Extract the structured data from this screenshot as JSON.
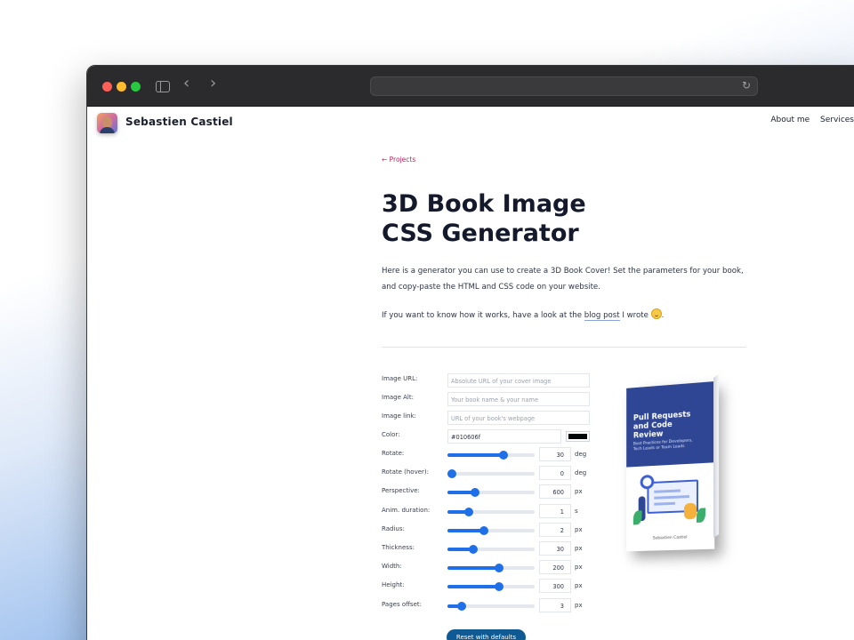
{
  "browser": {
    "url": ""
  },
  "site": {
    "name": "Sebastien Castiel",
    "nav": [
      "About me",
      "Services"
    ]
  },
  "article": {
    "back_link": "← Projects",
    "title_line1": "3D Book Image",
    "title_line2": "CSS Generator",
    "intro": "Here is a generator you can use to create a 3D Book Cover! Set the parameters for your book, and copy-paste the HTML and CSS code on your website.",
    "intro2_before": "If you want to know how it works, have a look at the ",
    "intro2_link": "blog post",
    "intro2_after": " I wrote",
    "intro2_end": "."
  },
  "form": {
    "image_url": {
      "label": "Image URL:",
      "placeholder": "Absolute URL of your cover image"
    },
    "image_alt": {
      "label": "Image Alt:",
      "placeholder": "Your book name & your name"
    },
    "image_link": {
      "label": "Image link:",
      "placeholder": "URL of your book's webpage"
    },
    "color": {
      "label": "Color:",
      "value": "#010606f",
      "swatch": "#010606"
    },
    "sliders": [
      {
        "label": "Rotate:",
        "value": "30",
        "unit": "deg",
        "fraction": 0.64
      },
      {
        "label": "Rotate (hover):",
        "value": "0",
        "unit": "deg",
        "fraction": 0.05
      },
      {
        "label": "Perspective:",
        "value": "600",
        "unit": "px",
        "fraction": 0.32
      },
      {
        "label": "Anim. duration:",
        "value": "1",
        "unit": "s",
        "fraction": 0.24
      },
      {
        "label": "Radius:",
        "value": "2",
        "unit": "px",
        "fraction": 0.42
      },
      {
        "label": "Thickness:",
        "value": "30",
        "unit": "px",
        "fraction": 0.3
      },
      {
        "label": "Width:",
        "value": "200",
        "unit": "px",
        "fraction": 0.59
      },
      {
        "label": "Height:",
        "value": "300",
        "unit": "px",
        "fraction": 0.59
      },
      {
        "label": "Pages offset:",
        "value": "3",
        "unit": "px",
        "fraction": 0.16
      }
    ],
    "reset_label": "Reset with defaults"
  },
  "book": {
    "title": "Pull Requests and Code Review",
    "subtitle": "Best Practices for Developers, Tech Leads or Team Leads",
    "author": "Sebastien Castiel",
    "cover_color": "#2e4694"
  }
}
